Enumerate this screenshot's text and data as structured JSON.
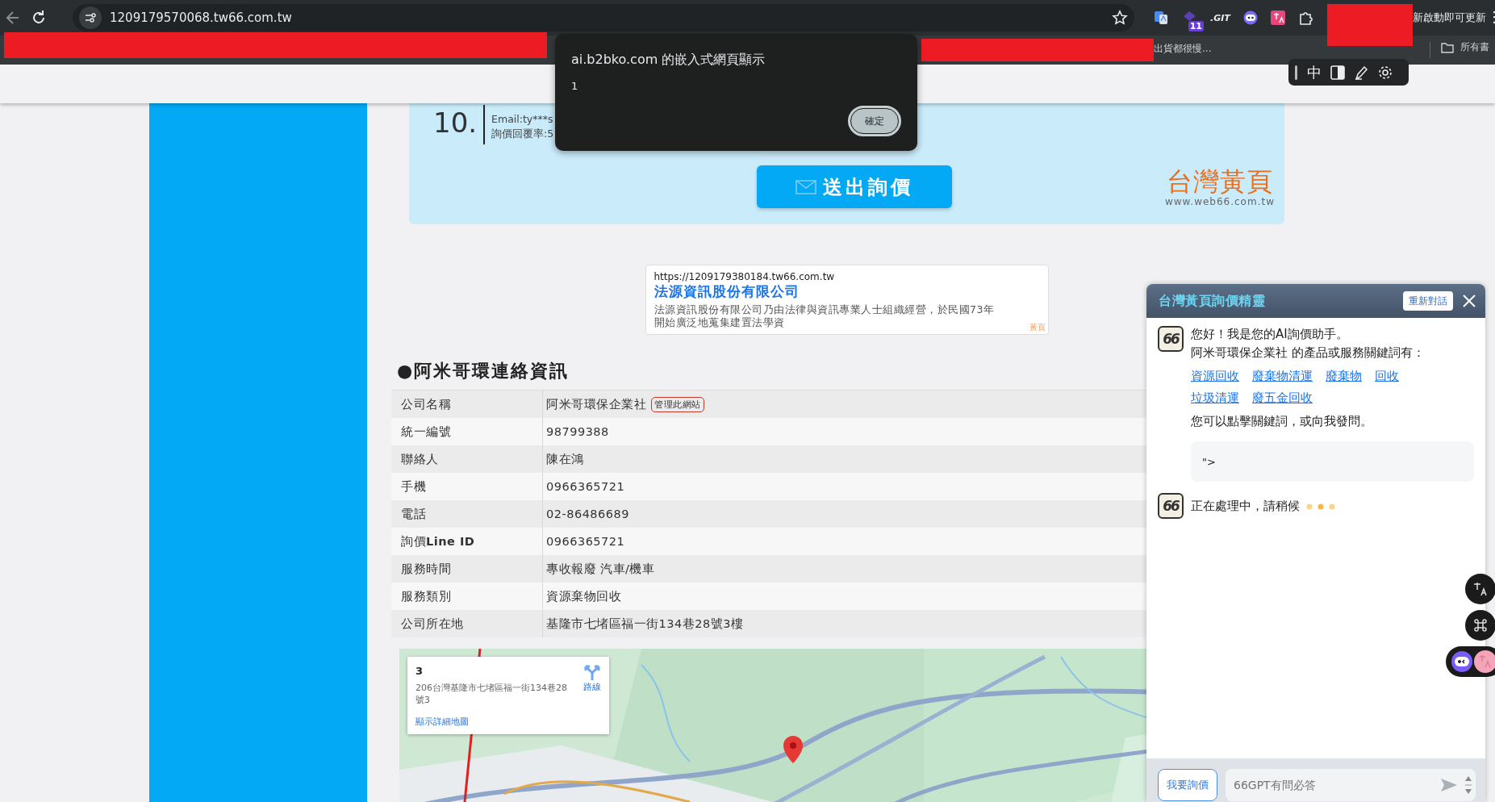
{
  "browser": {
    "url": "1209179570068.tw66.com.tw",
    "extension_badge": "11",
    "extension_label": ".GIT",
    "update_notice": "新啟動即可更新",
    "menu": "⋮"
  },
  "bookmarks": {
    "items": [
      {
        "label": "出貨都很慢..."
      }
    ],
    "all_bookmarks": "所有書"
  },
  "page_toolbar": {
    "language": "中"
  },
  "inquiry_card": {
    "rank": "10.",
    "lines": [
      "Email:ty***s",
      "詢價回覆率:5"
    ],
    "submit": "送出詢價",
    "logo_title": "台灣黃頁",
    "logo_url": "www.web66.com.tw"
  },
  "ad": {
    "url": "https://1209179380184.tw66.com.tw",
    "title": "法源資訊股份有限公司",
    "description_lines": [
      "法源資訊股份有限公司乃由法律與資訊專業人士組織經營，於民國73年",
      "開始廣泛地蒐集建置法學資"
    ],
    "tag": "黃頁"
  },
  "contact": {
    "heading": "●阿米哥環連絡資訊",
    "rows": [
      {
        "label": "公司名稱",
        "value": "阿米哥環保企業社",
        "badge": "管理此網站"
      },
      {
        "label": "統一編號",
        "value": "98799388"
      },
      {
        "label": "聯絡人",
        "value": "陳在鴻"
      },
      {
        "label": "手機",
        "value": "0966365721"
      },
      {
        "label": "電話",
        "value": "02-86486689"
      },
      {
        "label": "詢價**Line ID**",
        "value": "0966365721"
      },
      {
        "label": "服務時間",
        "value": "專收報廢 汽車/機車"
      },
      {
        "label": "服務類別",
        "value": "資源棄物回收"
      },
      {
        "label": "公司所在地",
        "value": "基隆市七堵區福一街134巷28號3樓"
      }
    ]
  },
  "map": {
    "kind": "picture",
    "info": {
      "title": "3",
      "address_lines": [
        "206台灣基隆市七堵區福一街134巷28",
        "號3"
      ],
      "directions": "路線",
      "link": "顯示詳細地圖"
    }
  },
  "dialog": {
    "title": "ai.b2bko.com 的嵌入式網頁顯示",
    "message": "1",
    "button": "確定"
  },
  "chat": {
    "title": "台灣黃頁詢價精靈",
    "restart": "重新對話",
    "messages": [
      {
        "kind": "greeting",
        "avatar": "66",
        "lines": [
          "您好！我是您的AI詢價助手。",
          "阿米哥環保企業社 的產品或服務關鍵詞有："
        ],
        "keywords": [
          "資源回收",
          "廢棄物清運",
          "廢棄物",
          "回收",
          "垃圾清運",
          "廢五金回收"
        ],
        "footer": "您可以點擊關鍵詞，或向我發問。",
        "snippet": "\">"
      },
      {
        "kind": "typing",
        "avatar": "66",
        "text": "正在處理中，請稍候"
      }
    ],
    "inquire_button": "我要詢價",
    "input_placeholder": "66GPT有問必答"
  }
}
